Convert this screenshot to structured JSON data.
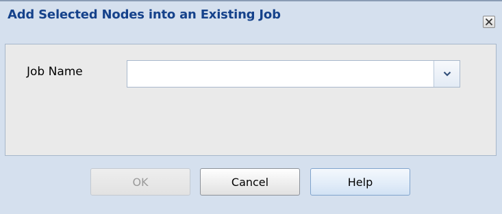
{
  "dialog": {
    "title": "Add Selected Nodes into an Existing Job",
    "close_icon": "close-x-icon"
  },
  "form": {
    "job_name_label": "Job Name",
    "job_name_value": "",
    "dropdown_icon": "chevron-down-icon"
  },
  "buttons": {
    "ok_label": "OK",
    "ok_enabled": false,
    "cancel_label": "Cancel",
    "help_label": "Help"
  },
  "colors": {
    "title_text": "#15428b",
    "dialog_background": "#d5e0ee",
    "panel_background": "#eaeaea"
  }
}
